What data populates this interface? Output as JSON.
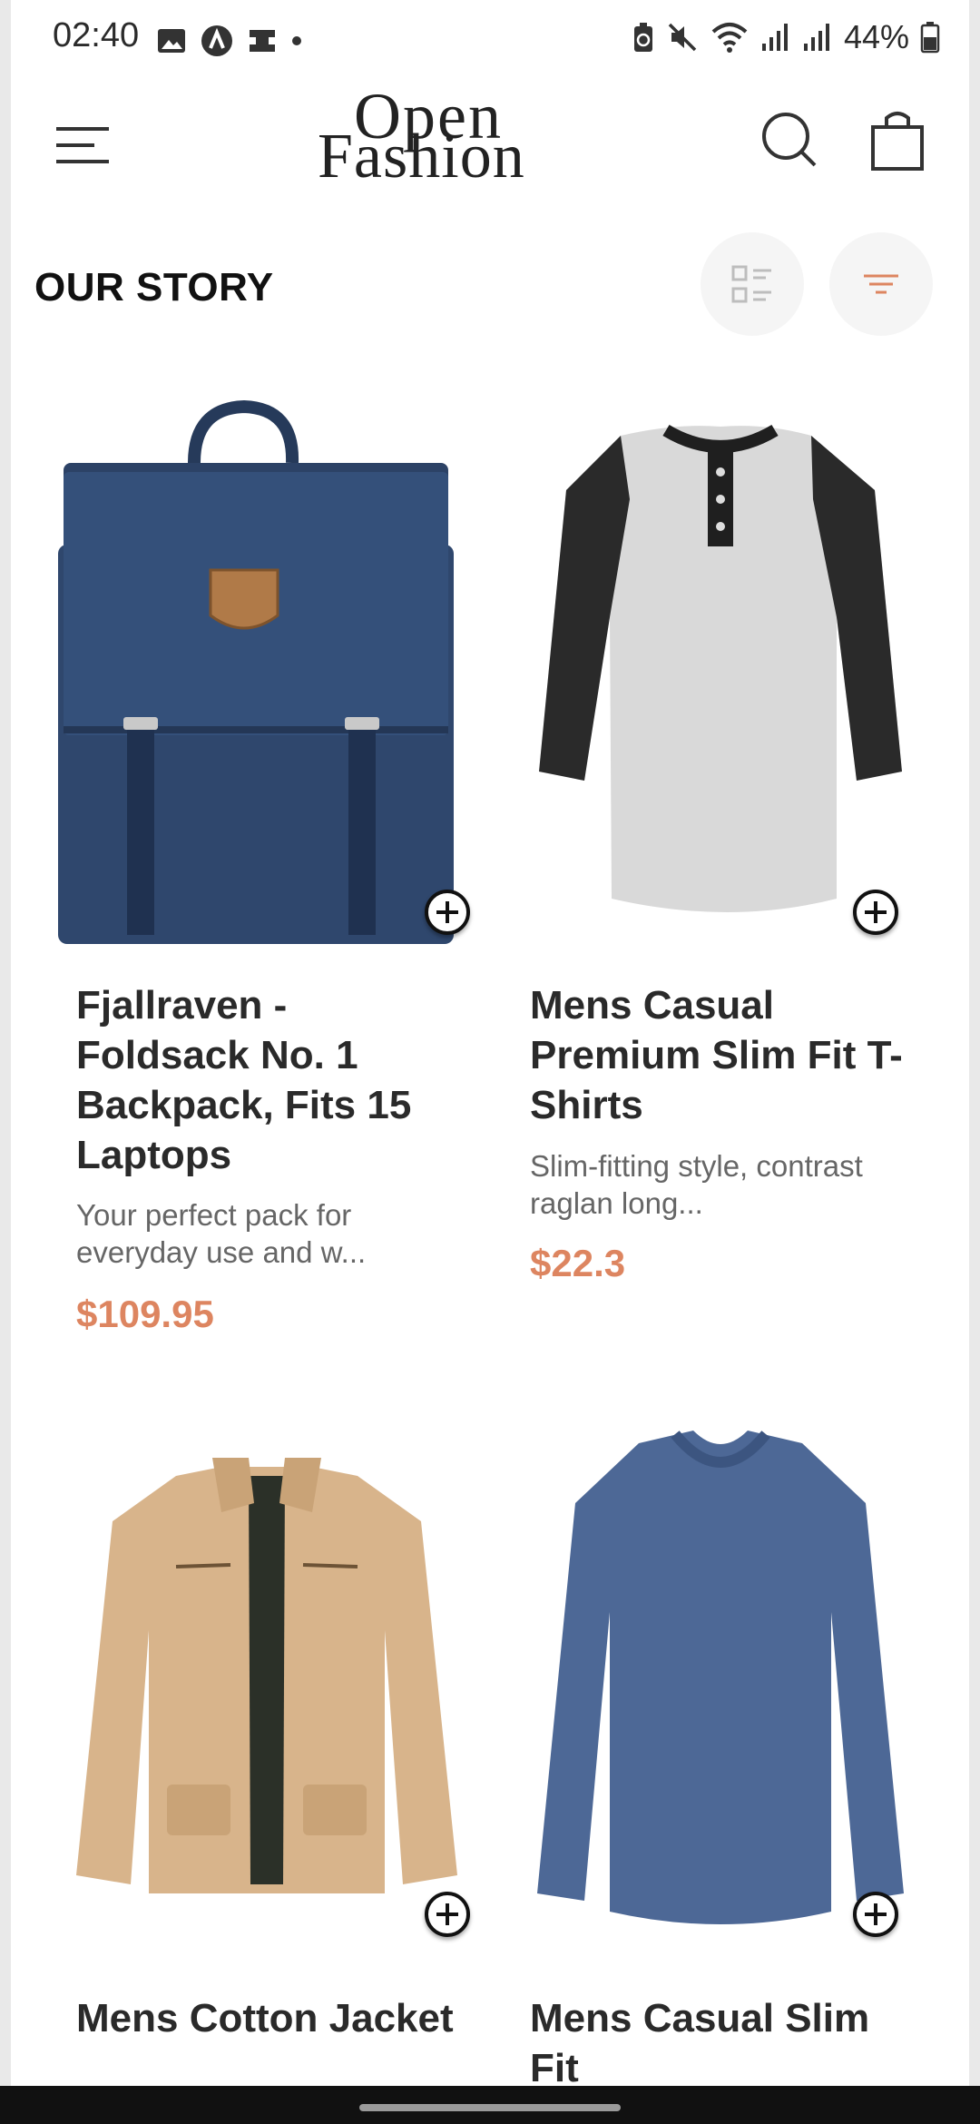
{
  "status_bar": {
    "time": "02:40",
    "battery_text": "44%",
    "left_icons": [
      "image-icon",
      "app-icon",
      "cast-icon",
      "dot-icon"
    ],
    "right_icons": [
      "battery-saver-icon",
      "mute-icon",
      "wifi-icon",
      "signal-icon",
      "signal-icon",
      "battery-icon"
    ]
  },
  "header": {
    "logo_line1": "Open",
    "logo_line2": "Fashion",
    "icons": [
      "menu-icon",
      "search-icon",
      "shopping-bag-icon"
    ]
  },
  "section": {
    "title": "OUR STORY",
    "icons": [
      "list-view-icon",
      "filter-icon"
    ]
  },
  "colors": {
    "accent": "#dd8560",
    "text": "#2a2a2a",
    "muted": "#666666"
  },
  "products": [
    {
      "title": "Fjallraven - Foldsack No. 1 Backpack, Fits 15 Laptops",
      "description": "Your perfect pack for everyday use and w...",
      "price": "$109.95",
      "image": "backpack"
    },
    {
      "title": "Mens Casual Premium Slim Fit T-Shirts",
      "description": "Slim-fitting style, contrast raglan long...",
      "price": "$22.3",
      "image": "raglan-shirt"
    },
    {
      "title": "Mens Cotton Jacket",
      "image": "jacket"
    },
    {
      "title": "Mens Casual Slim Fit",
      "image": "long-sleeve-shirt"
    }
  ]
}
